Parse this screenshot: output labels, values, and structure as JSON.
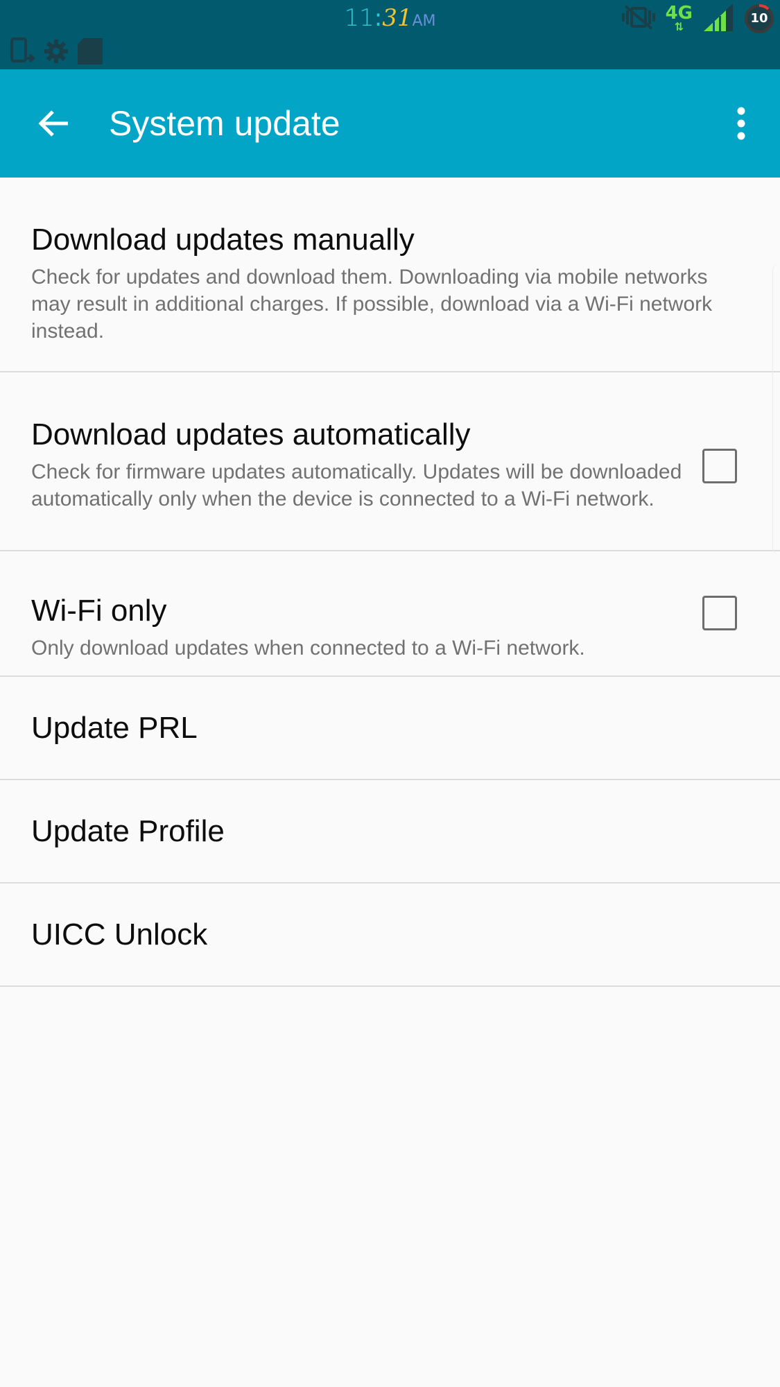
{
  "status_bar": {
    "time_hours": "11",
    "time_separator": ":",
    "time_minutes": "31",
    "time_ampm": "AM",
    "network_type": "4G",
    "network_arrows": "⇅",
    "battery_level": "10",
    "background_color": "#025a6e",
    "notification_icons": [
      "phone-transfer-icon",
      "gear-icon",
      "sd-card-icon"
    ],
    "system_icons": [
      "vibrate-muted-icon",
      "signal-strength-icon",
      "battery-icon"
    ]
  },
  "app_bar": {
    "title": "System update",
    "background_color": "#02a5c5",
    "back_icon": "arrow-back-icon",
    "more_icon": "more-vertical-icon"
  },
  "settings": [
    {
      "title": "Download updates manually",
      "summary": "Check for updates and download them. Downloading via mobile networks may result in additional charges. If possible, download via a Wi-Fi network instead.",
      "has_checkbox": false
    },
    {
      "title": "Download updates automatically",
      "summary": "Check for firmware updates automatically. Updates will be downloaded automatically only when the device is connected to a Wi-Fi network.",
      "has_checkbox": true,
      "checked": false
    },
    {
      "title": "Wi-Fi only",
      "summary": "Only download updates when connected to a Wi-Fi network.",
      "has_checkbox": true,
      "checked": false
    },
    {
      "title": "Update PRL",
      "has_checkbox": false
    },
    {
      "title": "Update Profile",
      "has_checkbox": false
    },
    {
      "title": "UICC Unlock",
      "has_checkbox": false
    }
  ]
}
